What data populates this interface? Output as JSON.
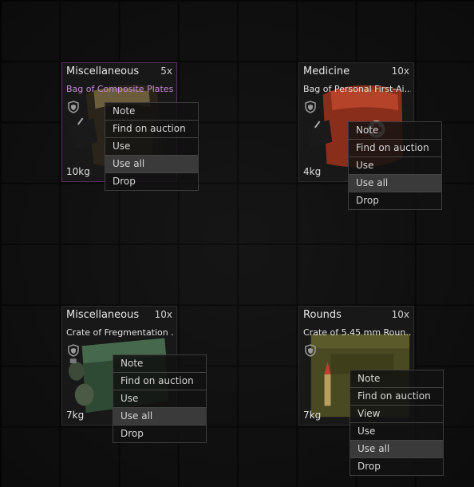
{
  "items": [
    {
      "category": "Miscellaneous",
      "quantity": "5x",
      "name": "Bag of Composite Plates...",
      "weight": "10kg",
      "menu": [
        "Note",
        "Find on auction",
        "Use",
        "Use all",
        "Drop"
      ]
    },
    {
      "category": "Medicine",
      "quantity": "10x",
      "name": "Bag of Personal First-Ai...",
      "weight": "4kg",
      "menu": [
        "Note",
        "Find on auction",
        "Use",
        "Use all",
        "Drop"
      ]
    },
    {
      "category": "Miscellaneous",
      "quantity": "10x",
      "name": "Crate of Fregmentation ...",
      "weight": "7kg",
      "menu": [
        "Note",
        "Find on auction",
        "Use",
        "Use all",
        "Drop"
      ]
    },
    {
      "category": "Rounds",
      "quantity": "10x",
      "name": "Crate of 5.45 mm Roun...",
      "weight": "7kg",
      "menu": [
        "Note",
        "Find on auction",
        "View",
        "Use",
        "Use all",
        "Drop"
      ]
    }
  ],
  "colors": {
    "rare_name": "#c88bd8",
    "menu_highlight": "#3a3a3a"
  },
  "icons": [
    "shield-icon",
    "bag-icon",
    "medkit-icon",
    "grenade-crate-icon",
    "ammo-crate-icon"
  ]
}
